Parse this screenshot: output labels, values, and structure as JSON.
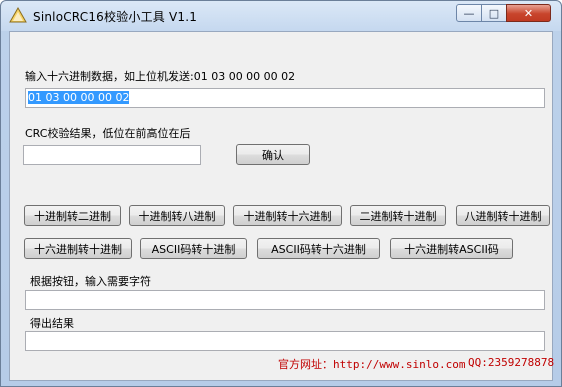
{
  "window": {
    "title": "SinloCRC16校验小工具 V1.1",
    "min_glyph": "—",
    "max_glyph": "□",
    "close_glyph": "✕"
  },
  "input_section": {
    "label": "输入十六进制数据，如上位机发送:01 03 00 00 00 02",
    "value": "01 03 00 00 00 02"
  },
  "crc_section": {
    "label": "CRC校验结果，低位在前高位在后",
    "value": "",
    "confirm_label": "确认"
  },
  "convert_buttons": [
    "十进制转二进制",
    "十进制转八进制",
    "十进制转十六进制",
    "二进制转十进制",
    "八进制转十进制",
    "十六进制转十进制",
    "ASCII码转十进制",
    "ASCII码转十六进制",
    "十六进制转ASCII码"
  ],
  "char_section": {
    "label": "根据按钮，输入需要字符",
    "value": ""
  },
  "result_section": {
    "label": "得出结果",
    "value": ""
  },
  "footer": {
    "site_label": "官方网址：http://www.sinlo.com",
    "qq_label": "QQ:2359278878"
  },
  "colors": {
    "link": "#c00000",
    "selection": "#3399ff"
  }
}
